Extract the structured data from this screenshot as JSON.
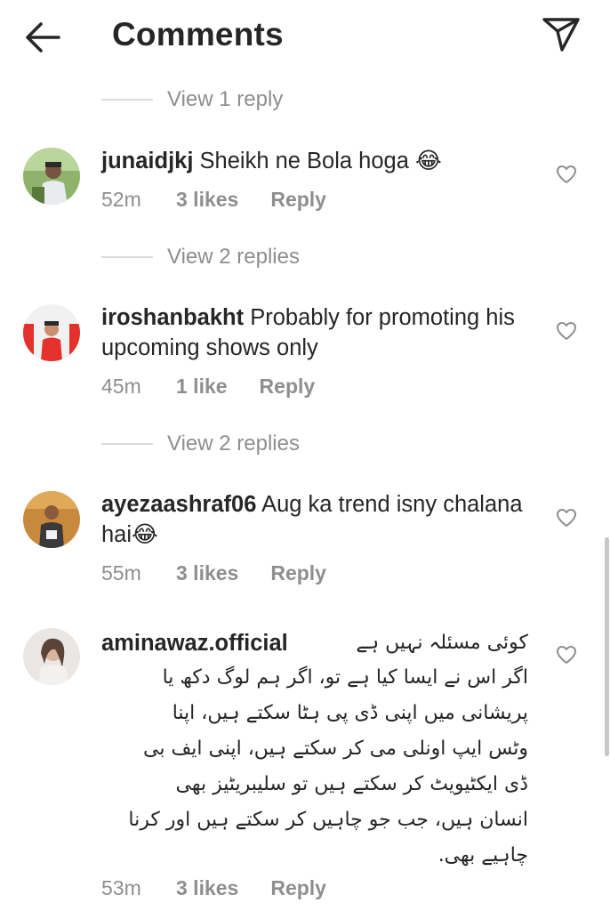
{
  "header": {
    "title": "Comments",
    "back_icon": "arrow-left-icon",
    "send_icon": "paper-plane-icon"
  },
  "view_replies": {
    "r1": "View 1 reply",
    "r2": "View 2 replies",
    "r3": "View 2 replies"
  },
  "comments": [
    {
      "username": "junaidjkj",
      "text": "Sheikh ne Bola hoga 😂",
      "time": "52m",
      "likes": "3 likes",
      "reply": "Reply"
    },
    {
      "username": "iroshanbakht",
      "text": "Probably for promoting his upcoming shows only",
      "time": "45m",
      "likes": "1 like",
      "reply": "Reply"
    },
    {
      "username": "ayezaashraf06",
      "text": "Aug ka trend isny chalana hai😂",
      "time": "55m",
      "likes": "3 likes",
      "reply": "Reply"
    },
    {
      "username": "aminawaz.official",
      "first_line": "کوئی مسئلہ نہیں ہے",
      "text": "اگر اس نے ایسا کیا ہے تو، اگر ہم لوگ دکھ یا\nپریشانی میں اپنی ڈی پی ہٹا سکتے ہیں، اپنا\nوٹس ایپ اونلی می کر سکتے ہیں، اپنی ایف بی\nڈی ایکٹیویٹ کر سکتے ہیں تو سلیبریٹیز بھی\nانسان ہیں، جب جو چاہیں کر سکتے ہیں اور کرنا\nچاہیے بھی.",
      "time": "53m",
      "likes": "3 likes",
      "reply": "Reply"
    }
  ]
}
